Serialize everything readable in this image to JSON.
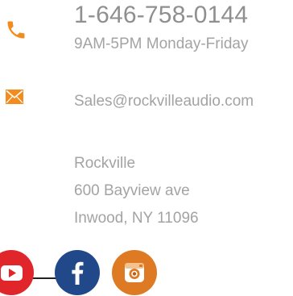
{
  "contact": {
    "phone": {
      "icon": "phone-icon",
      "number": "1-646-758-0144",
      "hours": "9AM-5PM Monday-Friday"
    },
    "email": {
      "icon": "envelope-icon",
      "address": "Sales@rockvilleaudio.com"
    },
    "address": {
      "line1": "Rockville",
      "line2": "600 Bayview ave",
      "line3": "Inwood, NY 11096"
    }
  },
  "social": [
    {
      "name": "YouTube",
      "icon": "youtube-icon",
      "color": "#e0262a"
    },
    {
      "name": "Facebook",
      "icon": "facebook-icon",
      "color": "#21498a"
    },
    {
      "name": "Instagram",
      "icon": "instagram-icon",
      "color": "#de7a23"
    }
  ],
  "colors": {
    "accent_orange": "#f28c1e",
    "text_gray": "#a3a3a3"
  }
}
